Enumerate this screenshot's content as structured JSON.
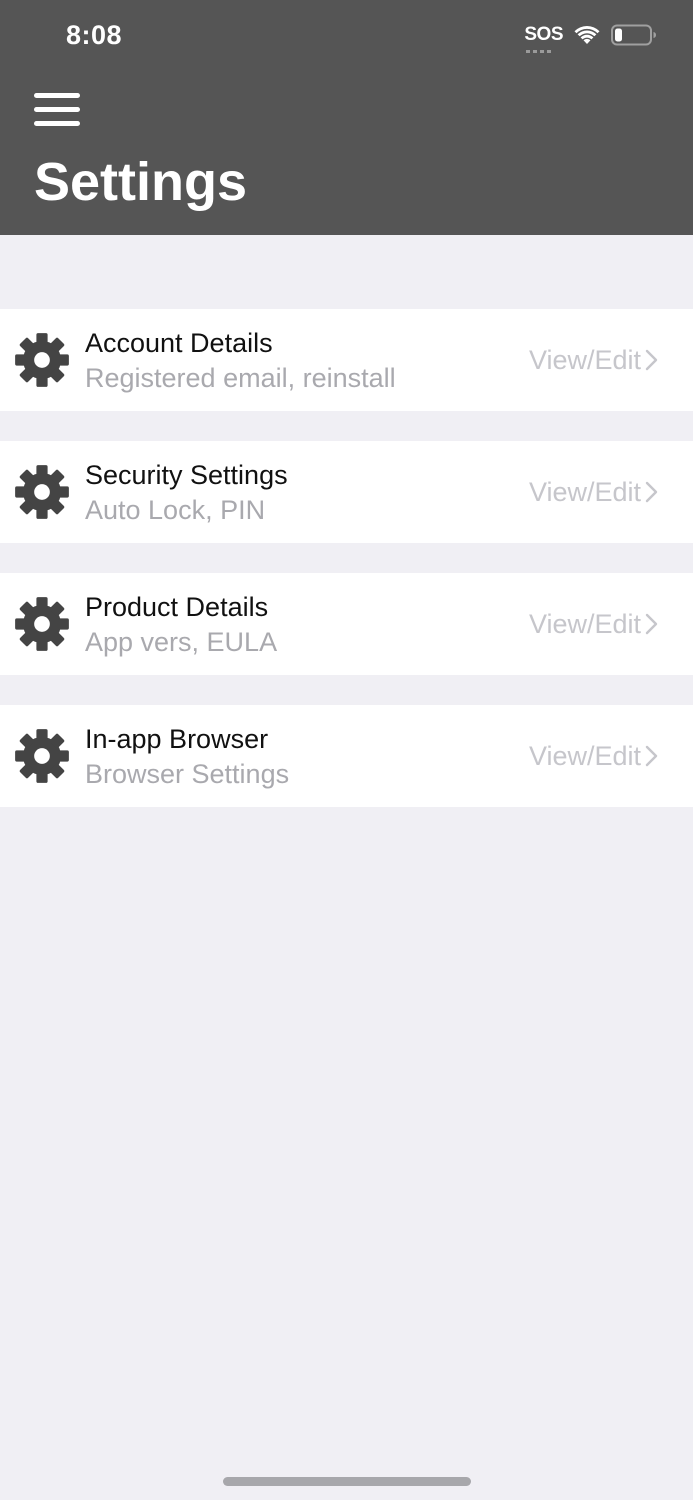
{
  "status_bar": {
    "time": "8:08",
    "carrier": "SOS",
    "battery_level": 0.2
  },
  "header": {
    "menu_icon": "hamburger-menu-icon",
    "title": "Settings"
  },
  "settings": {
    "items": [
      {
        "title": "Account Details",
        "subtitle": "Registered email, reinstall",
        "action": "View/Edit",
        "icon": "gear-icon"
      },
      {
        "title": "Security Settings",
        "subtitle": "Auto Lock, PIN",
        "action": "View/Edit",
        "icon": "gear-icon"
      },
      {
        "title": "Product Details",
        "subtitle": "App vers, EULA",
        "action": "View/Edit",
        "icon": "gear-icon"
      },
      {
        "title": "In-app Browser",
        "subtitle": "Browser Settings",
        "action": "View/Edit",
        "icon": "gear-icon"
      }
    ]
  },
  "colors": {
    "header_bg": "#555555",
    "page_bg": "#f0eff4",
    "row_bg": "#ffffff",
    "icon": "#444444",
    "subtitle": "#a9a9ae",
    "action": "#c6c6cb"
  }
}
